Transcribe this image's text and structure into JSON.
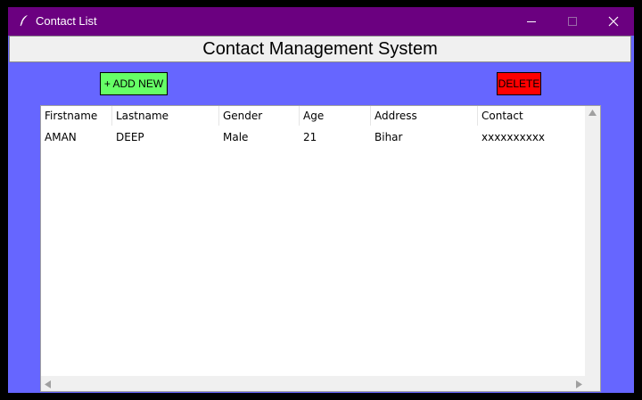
{
  "window": {
    "title": "Contact List",
    "titlebar_color": "#6b0080",
    "background_color": "#6666ff"
  },
  "heading": {
    "text": "Contact Management System"
  },
  "toolbar": {
    "add_label": "+ ADD NEW",
    "add_color": "#66ff66",
    "delete_label": "DELETE",
    "delete_color": "#ff0000"
  },
  "table": {
    "columns": [
      "Firstname",
      "Lastname",
      "Gender",
      "Age",
      "Address",
      "Contact"
    ],
    "rows": [
      [
        "AMAN",
        "DEEP",
        "Male",
        "21",
        "Bihar",
        "xxxxxxxxxx"
      ]
    ]
  },
  "icons": {
    "app": "feather-icon",
    "minimize": "minimize-icon",
    "maximize": "maximize-icon",
    "close": "close-icon"
  }
}
